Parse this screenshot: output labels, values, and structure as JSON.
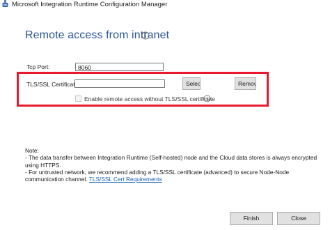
{
  "window": {
    "title": "Microsoft Integration Runtime Configuration Manager",
    "icon": "runtime-app-icon"
  },
  "page": {
    "title": "Remote access from intranet",
    "title_icon": "info-icon"
  },
  "form": {
    "tcp_port_label": "Tcp Port:",
    "tcp_port_value": "8060",
    "cert_label": "TLS/SSL Certificate:",
    "cert_value": "",
    "select_button": "Selec",
    "remove_button": "Remov",
    "enable_checkbox_label": "Enable remote access without TLS/SSL certificate",
    "enable_checkbox_checked": false
  },
  "note": {
    "heading": "Note:",
    "line1": " - The data transfer between Integration Runtime (Self-hosted) node and the Cloud data stores is always encrypted using HTTPS.",
    "line2": " - For untrusted network, we recommend adding a TLS/SSL certificate (advanced) to secure Node-Node communication channel.",
    "link": "TLS/SSL Cert Requirements"
  },
  "footer": {
    "finish_button": "Finish",
    "close_button": "Close"
  },
  "colors": {
    "title": "#2b5797",
    "highlight": "#e8192c",
    "link": "#1a5fb4"
  }
}
